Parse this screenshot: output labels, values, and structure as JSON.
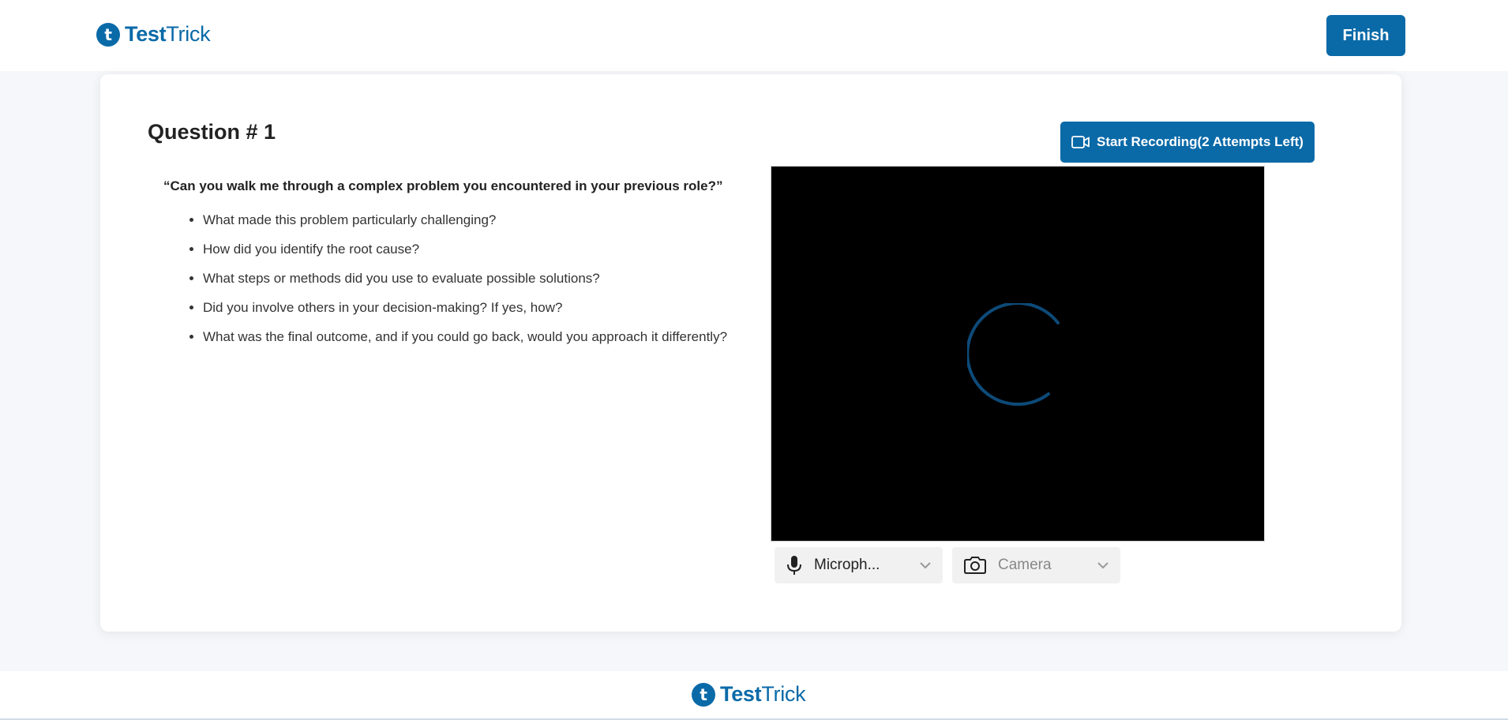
{
  "header": {
    "logo": {
      "part1": "Test",
      "part2": "Trick",
      "mark": "t"
    },
    "finish_label": "Finish"
  },
  "question": {
    "title": "Question # 1",
    "prompt": "“Can you walk me through a complex problem you encountered in your previous role?”",
    "points": [
      "What made this problem particularly challenging?",
      "How did you identify the root cause?",
      "What steps or methods did you use to evaluate possible solutions?",
      "Did you involve others in your decision-making? If yes, how?",
      "What was the final outcome, and if you could go back, would you approach it differently?"
    ]
  },
  "recorder": {
    "start_label": "Start Recording(2 Attempts Left)",
    "record_icon": "video-camera-icon",
    "loading_icon": "spinner-icon",
    "microphone": {
      "icon": "microphone-icon",
      "value": "Microph..."
    },
    "camera": {
      "icon": "camera-icon",
      "value": "Camera"
    }
  },
  "footer": {
    "logo": {
      "part1": "Test",
      "part2": "Trick",
      "mark": "t"
    }
  },
  "colors": {
    "brand": "#0a6aa8",
    "background": "#f5f7fa",
    "video": "#000000",
    "spinner": "#0d4a78"
  }
}
